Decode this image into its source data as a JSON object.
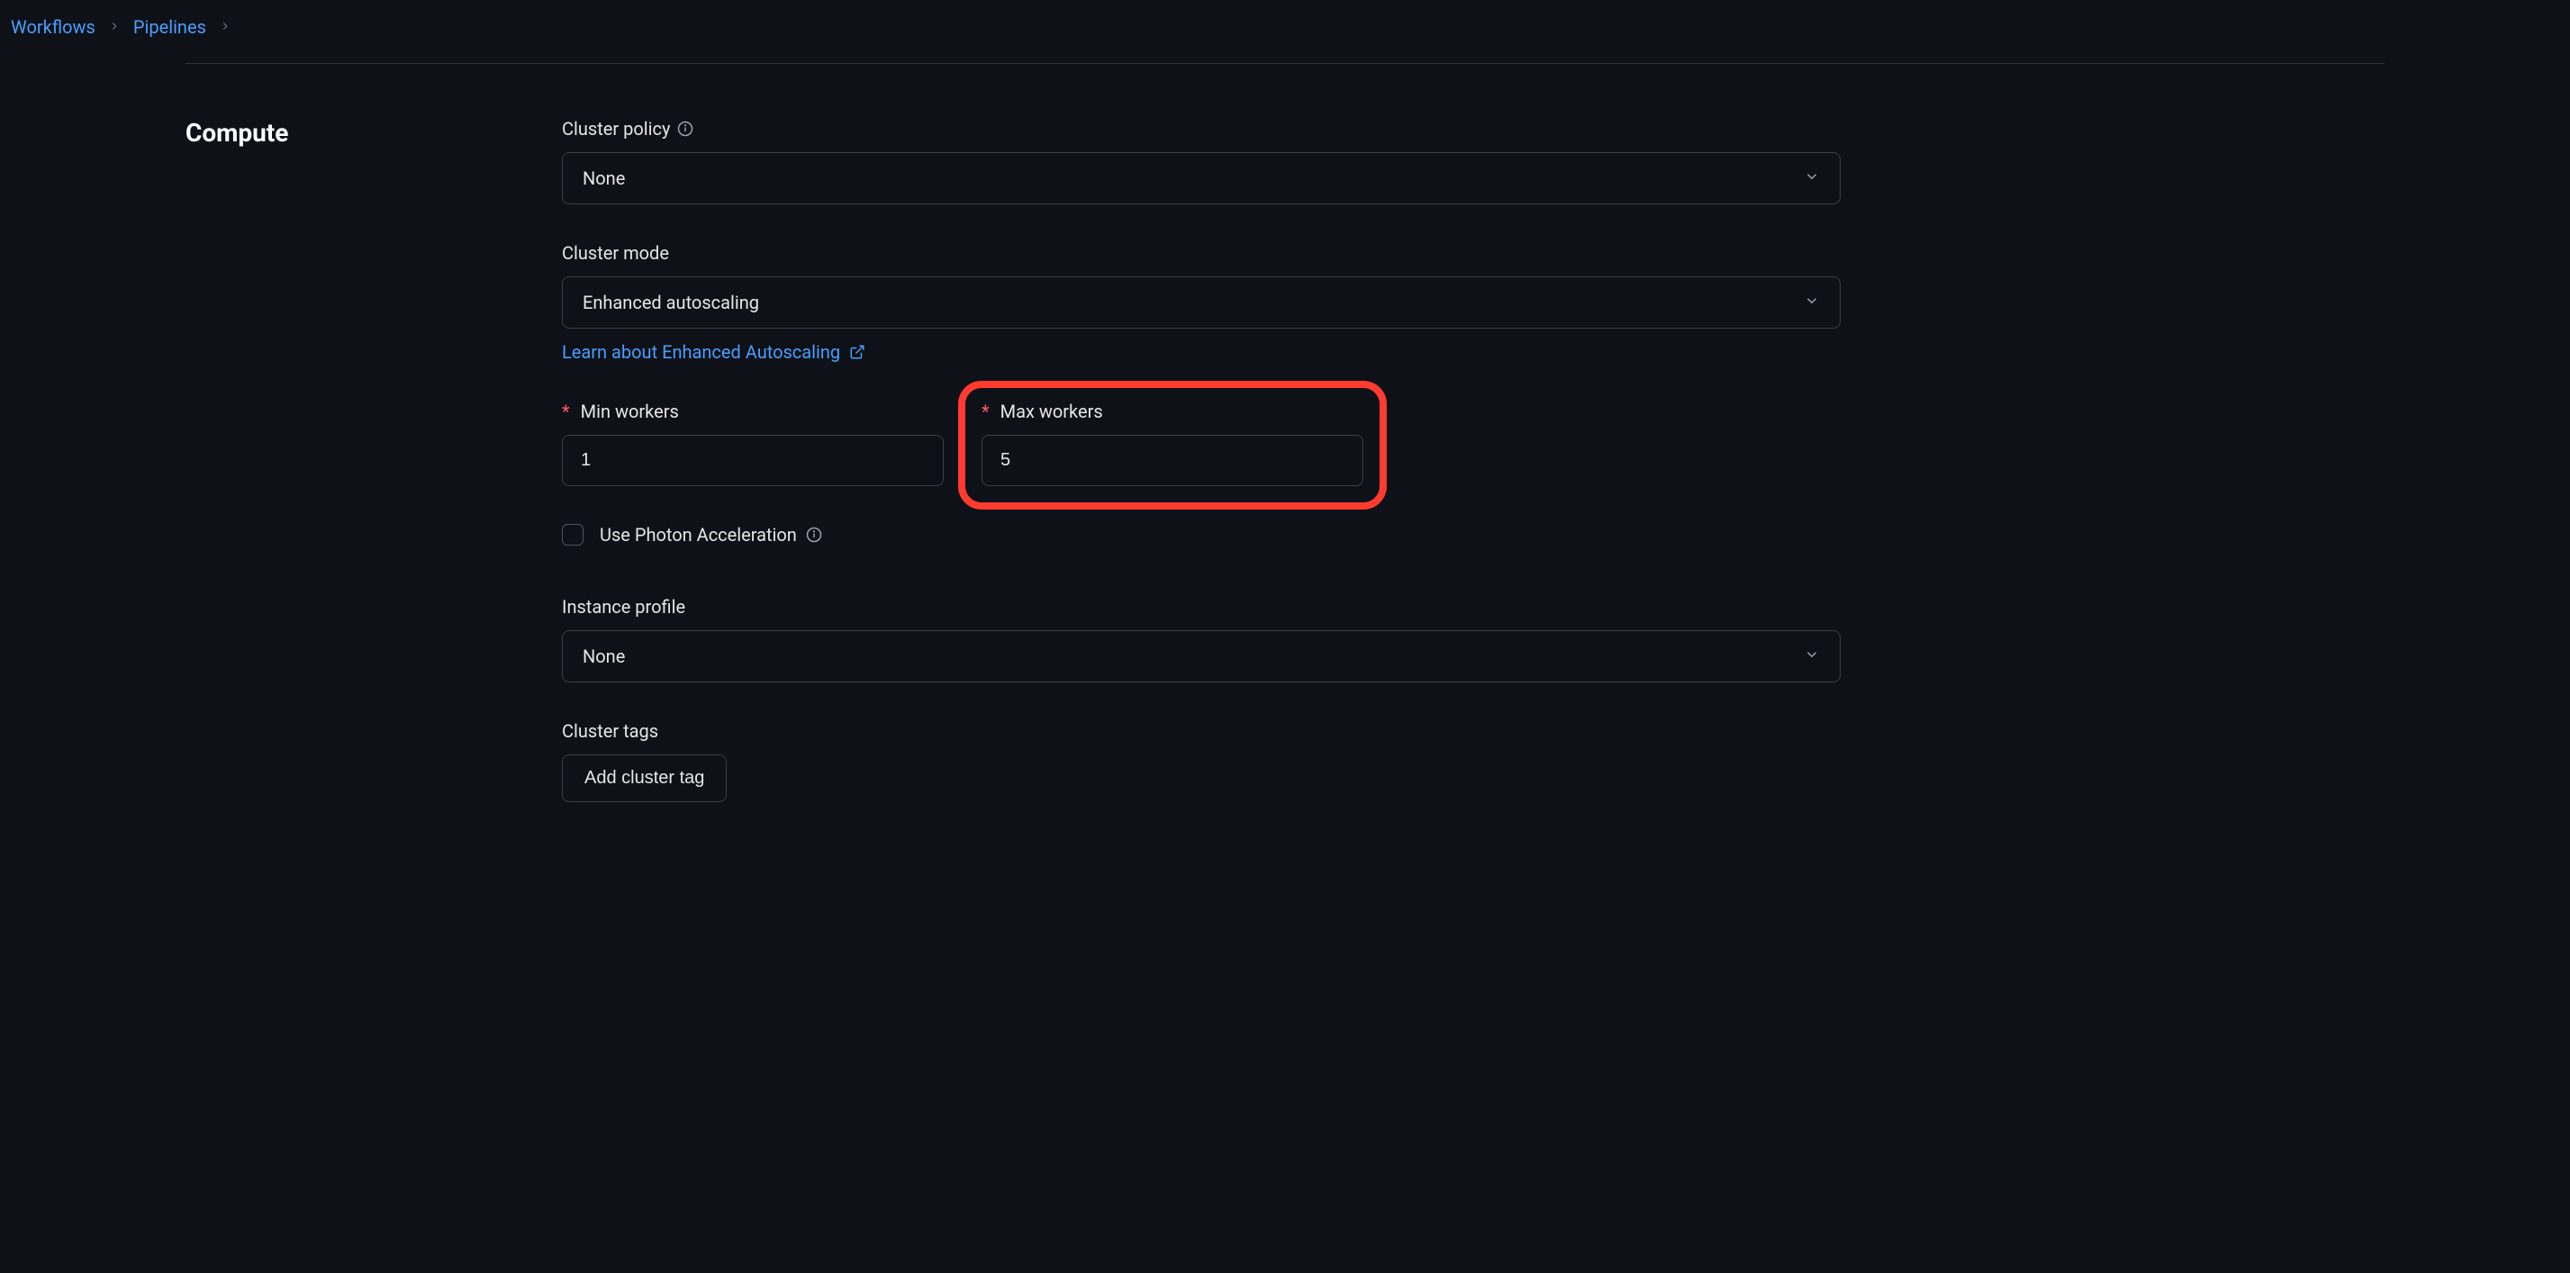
{
  "breadcrumb": {
    "item1": "Workflows",
    "item2": "Pipelines"
  },
  "section": {
    "title": "Compute"
  },
  "cluster_policy": {
    "label": "Cluster policy",
    "value": "None"
  },
  "cluster_mode": {
    "label": "Cluster mode",
    "value": "Enhanced autoscaling",
    "link_text": "Learn about Enhanced Autoscaling"
  },
  "min_workers": {
    "label": "Min workers",
    "value": "1"
  },
  "max_workers": {
    "label": "Max workers",
    "value": "5"
  },
  "photon": {
    "label": "Use Photon Acceleration"
  },
  "instance_profile": {
    "label": "Instance profile",
    "value": "None"
  },
  "cluster_tags": {
    "label": "Cluster tags",
    "button": "Add cluster tag"
  }
}
